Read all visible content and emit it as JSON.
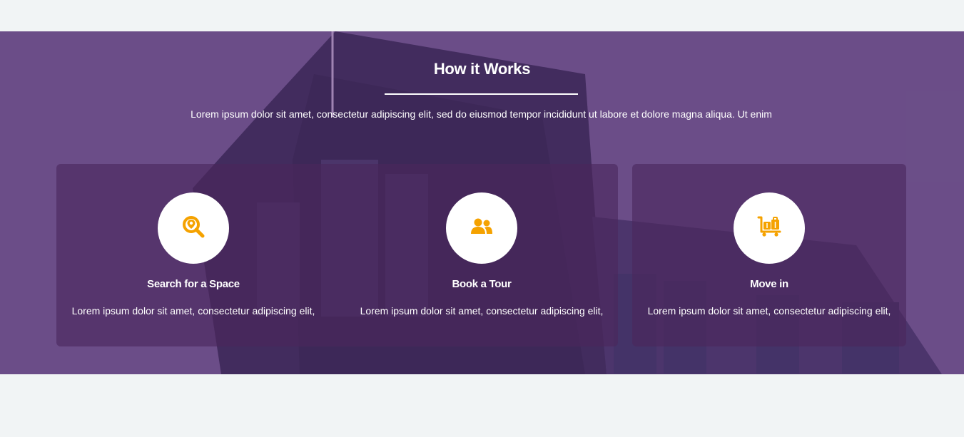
{
  "section": {
    "title": "How it Works",
    "intro": "Lorem ipsum dolor sit amet, consectetur adipiscing elit, sed do eiusmod tempor incididunt ut labore et dolore magna aliqua. Ut enim"
  },
  "colors": {
    "accent": "#f5a200",
    "overlay": "#4a265c",
    "text": "#ffffff",
    "page_background": "#f1f4f5"
  },
  "steps": [
    {
      "icon": "search-location-icon",
      "title": "Search for a Space",
      "text": "Lorem ipsum dolor sit amet, consectetur adipiscing elit,"
    },
    {
      "icon": "users-icon",
      "title": "Book a Tour",
      "text": "Lorem ipsum dolor sit amet, consectetur adipiscing elit,"
    },
    {
      "icon": "luggage-cart-icon",
      "title": "Move in",
      "text": "Lorem ipsum dolor sit amet, consectetur adipiscing elit,"
    }
  ]
}
